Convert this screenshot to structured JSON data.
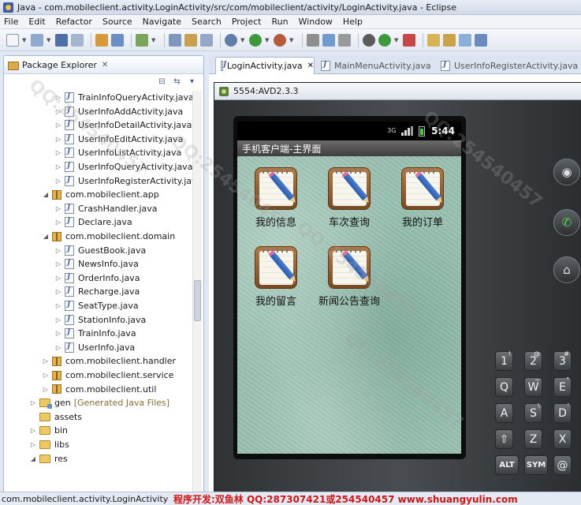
{
  "window": {
    "title": "Java - com.mobileclient.activity.LoginActivity/src/com/mobileclient/activity/LoginActivity.java - Eclipse"
  },
  "menu": [
    "File",
    "Edit",
    "Refactor",
    "Source",
    "Navigate",
    "Search",
    "Project",
    "Run",
    "Window",
    "Help"
  ],
  "explorer": {
    "title": "Package Explorer",
    "tree": [
      {
        "label": "TrainInfoQueryActivity.java",
        "icon": "java-file-icon",
        "twisty": "▷"
      },
      {
        "label": "UserInfoAddActivity.java",
        "icon": "java-file-icon",
        "twisty": "▷"
      },
      {
        "label": "UserInfoDetailActivity.java",
        "icon": "java-file-icon",
        "twisty": "▷"
      },
      {
        "label": "UserInfoEditActivity.java",
        "icon": "java-file-icon",
        "twisty": "▷"
      },
      {
        "label": "UserInfoListActivity.java",
        "icon": "java-file-icon",
        "twisty": "▷"
      },
      {
        "label": "UserInfoQueryActivity.java",
        "icon": "java-file-icon",
        "twisty": "▷"
      },
      {
        "label": "UserInfoRegisterActivity.java",
        "icon": "java-file-icon",
        "twisty": "▷"
      },
      {
        "label": "com.mobileclient.app",
        "icon": "package-icon",
        "twisty": "◢"
      },
      {
        "label": "CrashHandler.java",
        "icon": "java-file-icon",
        "twisty": "▷"
      },
      {
        "label": "Declare.java",
        "icon": "java-file-icon",
        "twisty": "▷"
      },
      {
        "label": "com.mobileclient.domain",
        "icon": "package-icon",
        "twisty": "◢"
      },
      {
        "label": "GuestBook.java",
        "icon": "java-file-icon",
        "twisty": "▷"
      },
      {
        "label": "NewsInfo.java",
        "icon": "java-file-icon",
        "twisty": "▷"
      },
      {
        "label": "OrderInfo.java",
        "icon": "java-file-icon",
        "twisty": "▷"
      },
      {
        "label": "Recharge.java",
        "icon": "java-file-icon",
        "twisty": "▷"
      },
      {
        "label": "SeatType.java",
        "icon": "java-file-icon",
        "twisty": "▷"
      },
      {
        "label": "StationInfo.java",
        "icon": "java-file-icon",
        "twisty": "▷"
      },
      {
        "label": "TrainInfo.java",
        "icon": "java-file-icon",
        "twisty": "▷"
      },
      {
        "label": "UserInfo.java",
        "icon": "java-file-icon",
        "twisty": "▷"
      },
      {
        "label": "com.mobileclient.handler",
        "icon": "package-icon",
        "twisty": "▷"
      },
      {
        "label": "com.mobileclient.service",
        "icon": "package-icon",
        "twisty": "▷"
      },
      {
        "label": "com.mobileclient.util",
        "icon": "package-icon",
        "twisty": "▷"
      },
      {
        "label": "gen",
        "note": "[Generated Java Files]",
        "icon": "gen-folder-icon",
        "twisty": "▷"
      },
      {
        "label": "assets",
        "icon": "folder-icon",
        "twisty": ""
      },
      {
        "label": "bin",
        "icon": "folder-icon",
        "twisty": "▷"
      },
      {
        "label": "libs",
        "icon": "folder-icon",
        "twisty": "▷"
      },
      {
        "label": "res",
        "icon": "folder-icon",
        "twisty": "◢"
      }
    ]
  },
  "editor": {
    "tabs": [
      {
        "label": "LoginActivity.java",
        "active": true
      },
      {
        "label": "MainMenuActivity.java",
        "active": false
      },
      {
        "label": "UserInfoRegisterActivity.java",
        "active": false
      }
    ]
  },
  "emulator": {
    "title": "5554:AVD2.3.3",
    "status_time": "5:44",
    "app_title": "手机客户端-主界面",
    "tiles": [
      {
        "label": "我的信息",
        "icon": "notepad-pencil-icon"
      },
      {
        "label": "车次查询",
        "icon": "notepad-pencil-icon"
      },
      {
        "label": "我的订单",
        "icon": "notepad-pencil-icon"
      },
      {
        "label": "我的留言",
        "icon": "notepad-pencil-icon"
      },
      {
        "label": "新闻公告查询",
        "icon": "notepad-pencil-icon"
      }
    ],
    "hardware_buttons": [
      "camera-icon",
      "call-icon",
      "home-icon"
    ],
    "keyboard": [
      {
        "main": "1",
        "sup": "!"
      },
      {
        "main": "2",
        "sup": "@"
      },
      {
        "main": "3",
        "sup": "#"
      },
      {
        "main": "Q",
        "sup": ""
      },
      {
        "main": "W",
        "sup": "~"
      },
      {
        "main": "E",
        "sup": "\""
      },
      {
        "main": "A",
        "sup": ""
      },
      {
        "main": "S",
        "sup": "\\"
      },
      {
        "main": "D",
        "sup": "'"
      },
      {
        "main": "⇧",
        "sup": ""
      },
      {
        "main": "Z",
        "sup": ""
      },
      {
        "main": "X",
        "sup": ""
      },
      {
        "main": "ALT",
        "sup": ""
      },
      {
        "main": "SYM",
        "sup": ""
      },
      {
        "main": "@",
        "sup": ""
      }
    ]
  },
  "status": {
    "text": "com.mobileclient.activity.LoginActivity",
    "credit": "程序开发:双鱼林 QQ:287307421或254540457 www.shuangyulin.com"
  },
  "watermark_text": "QQ:254540457"
}
